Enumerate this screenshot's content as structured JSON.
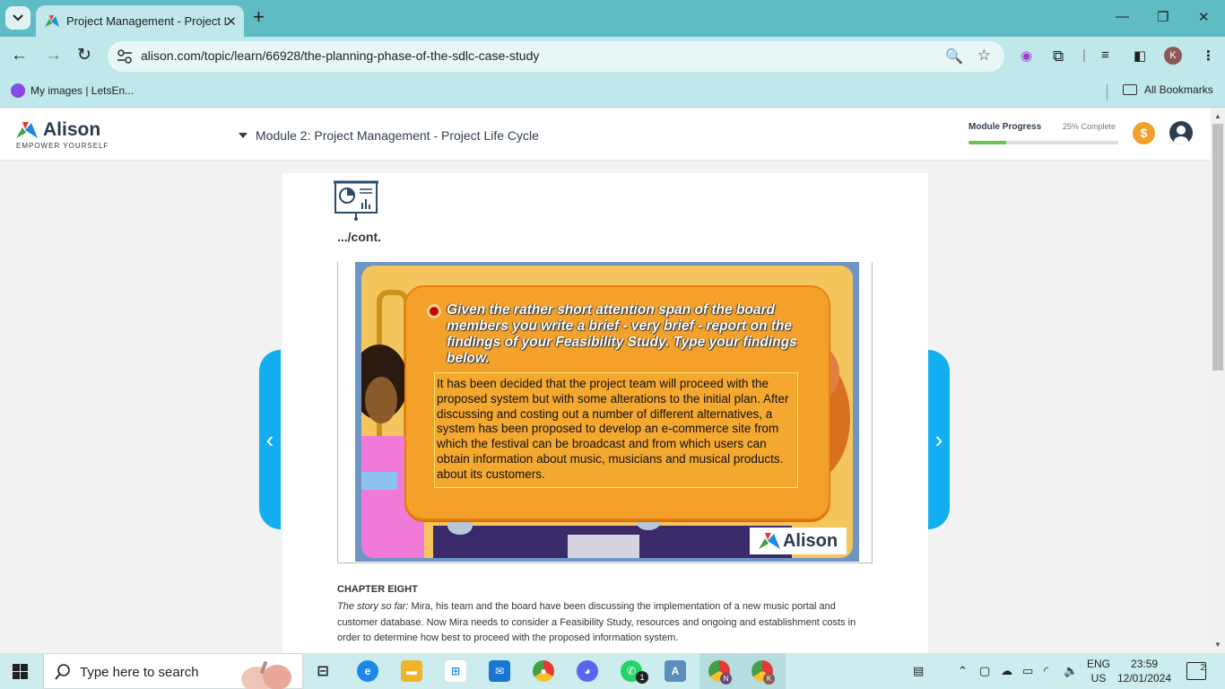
{
  "browser": {
    "tab_title": "Project Management - Project L",
    "url": "alison.com/topic/learn/66928/the-planning-phase-of-the-sdlc-case-study",
    "bookmark_item": "My images | LetsEn...",
    "all_bookmarks": "All Bookmarks",
    "profile_initial": "K"
  },
  "header": {
    "logo_name": "Alison",
    "logo_tagline": "EMPOWER YOURSELF",
    "module_title": "Module 2: Project Management - Project Life Cycle",
    "progress_label": "Module Progress",
    "progress_text": "25% Complete",
    "progress_value": 0.25,
    "coin_symbol": "$"
  },
  "content": {
    "cont_label": ".../cont.",
    "slide": {
      "prompt": "Given the rather short attention span of the board members you write a brief - very brief - report on the findings of your Feasibility Study. Type your findings below.",
      "answer": "It has been decided that the project team will proceed with the proposed system but with some alterations to the initial plan. After discussing and costing out a number of different alternatives, a system has been proposed to develop an e-commerce site from which the festival can be broadcast and from which users can obtain information about music, musicians and musical products. about its customers.",
      "watermark": "Alison"
    },
    "chapter_heading": "CHAPTER EIGHT",
    "story_lead": "The story so far:",
    "story_text": " Mira, his team and the board have been discussing the implementation of a new music portal and customer database. Now Mira needs to consider a Feasibility Study, resources and ongoing and establishment costs in order to determine how best to proceed with the proposed information system."
  },
  "nav": {
    "prev_arrow": "‹",
    "next_arrow": "›"
  },
  "taskbar": {
    "search_placeholder": "Type here to search",
    "whatsapp_badge": "1",
    "chrome_n_badge": "N",
    "chrome_k_badge": "K",
    "lang_line1": "ENG",
    "lang_line2": "US",
    "time": "23:59",
    "date": "12/01/2024",
    "notification_count": "2"
  },
  "colors": {
    "chrome_tabbar": "#5fbcc4",
    "chrome_toolbar": "#c0e7ea",
    "nav_arrow": "#13aef0",
    "progress_fill": "#6ac24a",
    "coin": "#f2a02c"
  }
}
